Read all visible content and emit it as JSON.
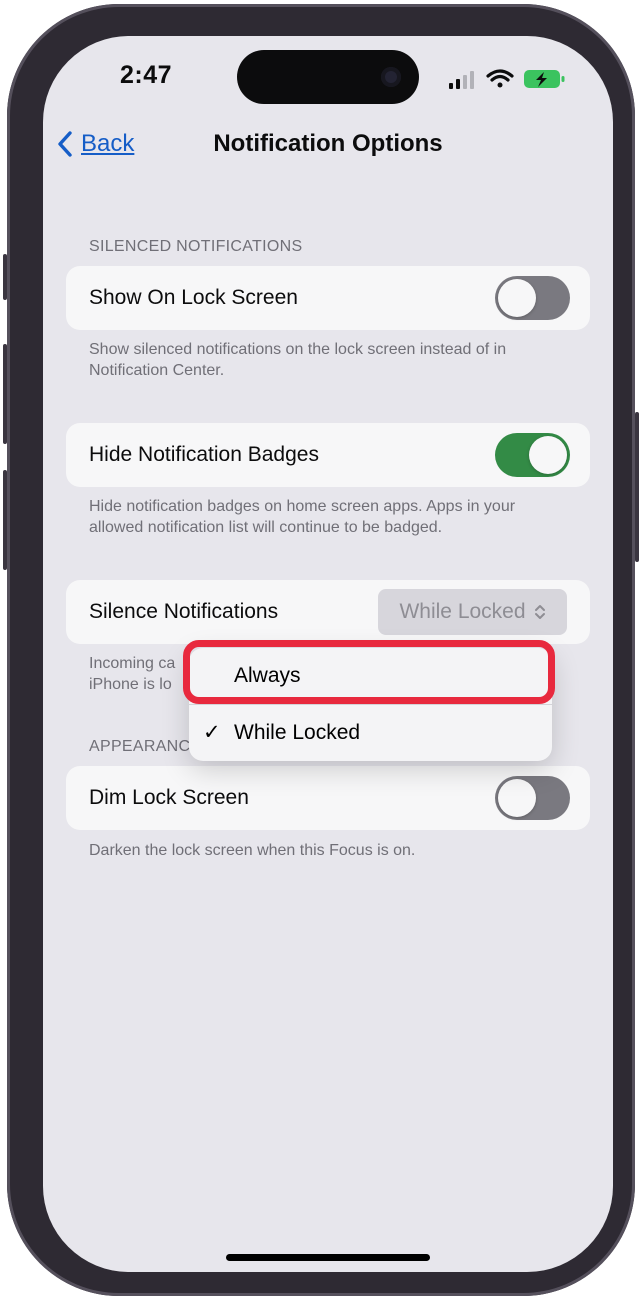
{
  "status_bar": {
    "time": "2:47"
  },
  "nav": {
    "back_label": "Back",
    "title": "Notification Options"
  },
  "silenced_section": {
    "header": "SILENCED NOTIFICATIONS",
    "show_on_lock_screen": {
      "label": "Show On Lock Screen",
      "enabled": false
    },
    "show_footnote": "Show silenced notifications on the lock screen instead of in Notification Center.",
    "hide_badges": {
      "label": "Hide Notification Badges",
      "enabled": true
    },
    "badges_footnote": "Hide notification badges on home screen apps. Apps in your allowed notification list will continue to be badged.",
    "silence_notifications": {
      "label": "Silence Notifications",
      "selected": "While Locked",
      "chevron": "⌃⌄"
    },
    "silence_footnote_partial": "Incoming ca\niPhone is lo"
  },
  "appearance_section": {
    "header_partial": "APPEARANC",
    "dim_lock_screen": {
      "label": "Dim Lock Screen",
      "enabled": false
    },
    "dim_footnote": "Darken the lock screen when this Focus is on."
  },
  "dropdown_menu": {
    "options": [
      {
        "label": "Always",
        "checked": false
      },
      {
        "label": "While Locked",
        "checked": true
      }
    ],
    "check_glyph": "✓"
  },
  "colors": {
    "toggle_on": "#2b8a3e",
    "toggle_off": "#78777d",
    "link": "#0a58ca",
    "highlight": "#e8293e"
  }
}
